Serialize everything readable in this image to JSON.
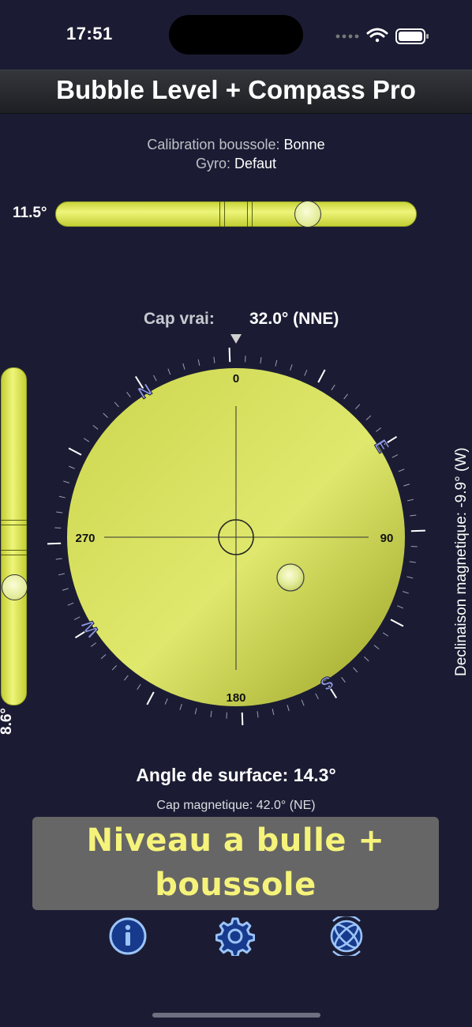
{
  "status_bar": {
    "time": "17:51"
  },
  "header": {
    "title": "Bubble Level + Compass Pro"
  },
  "calibration": {
    "compass_label": "Calibration boussole:",
    "compass_value": "Bonne",
    "gyro_label": "Gyro:",
    "gyro_value": "Defaut"
  },
  "horizontal_level": {
    "value": "11.5°"
  },
  "vertical_level": {
    "value": "8.6°"
  },
  "heading": {
    "label": "Cap vrai:",
    "value": "32.0° (NNE)"
  },
  "declination": "Declinaison magnetique: -9.9° (W)",
  "compass": {
    "rotation_deg": 32,
    "dial_labels": {
      "top": "0",
      "right": "90",
      "bottom": "180",
      "left": "270"
    },
    "cardinals": {
      "n": "N",
      "e": "E",
      "s": "S",
      "w": "W"
    },
    "colors": {
      "dial": "#d9e25a",
      "cardinal": "#8d97e6"
    }
  },
  "surface_angle": "Angle de surface: 14.3°",
  "magnetic_heading": "Cap magnetique: 42.0° (NE)",
  "banner": {
    "line1": "Niveau a bulle +",
    "line2": "boussole"
  },
  "toolbar": {
    "icons": [
      "info-icon",
      "gear-icon",
      "calibrate-sphere-icon"
    ],
    "accent": "#8fbdf5"
  }
}
